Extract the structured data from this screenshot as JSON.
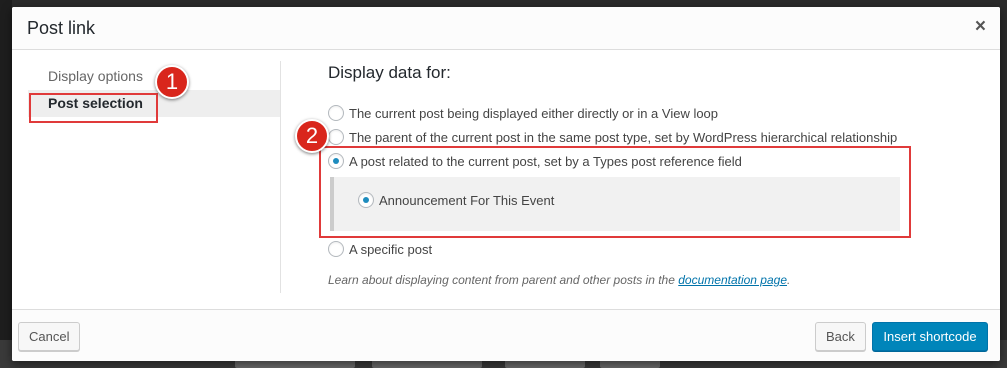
{
  "dialog": {
    "title": "Post link",
    "close_symbol": "×"
  },
  "nav": {
    "items": [
      {
        "label": "Display options",
        "active": false
      },
      {
        "label": "Post selection",
        "active": true
      }
    ]
  },
  "main": {
    "heading": "Display data for:",
    "options": [
      {
        "label": "The current post being displayed either directly or in a View loop",
        "checked": false
      },
      {
        "label": "The parent of the current post in the same post type, set by WordPress hierarchical relationship",
        "checked": false
      },
      {
        "label": "A post related to the current post, set by a Types post reference field",
        "checked": true
      },
      {
        "label": "A specific post",
        "checked": false
      }
    ],
    "sub_option": {
      "label": "Announcement For This Event",
      "checked": true
    },
    "note_text": "Learn about displaying content from parent and other posts in the",
    "note_link": "documentation page",
    "note_end": "."
  },
  "footer": {
    "cancel_label": "Cancel",
    "back_label": "Back",
    "insert_label": "Insert shortcode"
  },
  "annotations": {
    "badge_1": "1",
    "badge_2": "2",
    "color": "#e03a3a"
  },
  "colors": {
    "accent": "#0085ba",
    "radio_checked": "#1e8cbe"
  }
}
